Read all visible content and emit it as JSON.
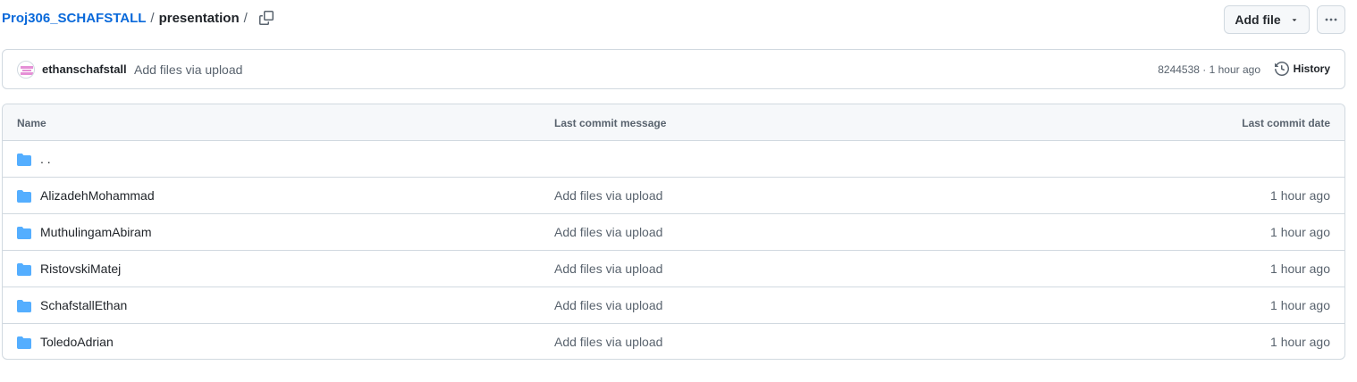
{
  "breadcrumb": {
    "repo": "Proj306_SCHAFSTALL",
    "sep1": "/",
    "folder": "presentation",
    "sep2": "/"
  },
  "actions": {
    "add_file_label": "Add file",
    "copy_icon": "copy-icon",
    "more_icon": "kebab-horizontal-icon"
  },
  "latest_commit": {
    "author": "ethanschafstall",
    "message": "Add files via upload",
    "sha": "8244538",
    "separator": " · ",
    "time": "1 hour ago",
    "history_label": "History"
  },
  "table": {
    "headers": {
      "name": "Name",
      "message": "Last commit message",
      "date": "Last commit date"
    },
    "parent_row": {
      "name": ". .",
      "message": "",
      "date": ""
    },
    "rows": [
      {
        "name": "AlizadehMohammad",
        "message": "Add files via upload",
        "date": "1 hour ago"
      },
      {
        "name": "MuthulingamAbiram",
        "message": "Add files via upload",
        "date": "1 hour ago"
      },
      {
        "name": "RistovskiMatej",
        "message": "Add files via upload",
        "date": "1 hour ago"
      },
      {
        "name": "SchafstallEthan",
        "message": "Add files via upload",
        "date": "1 hour ago"
      },
      {
        "name": "ToledoAdrian",
        "message": "Add files via upload",
        "date": "1 hour ago"
      }
    ]
  },
  "colors": {
    "link": "#0969da",
    "folder": "#54aeff",
    "border": "#d1d9e0",
    "header_bg": "#f6f8fa",
    "muted": "#59636e"
  }
}
